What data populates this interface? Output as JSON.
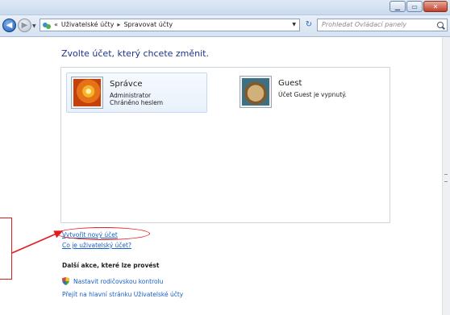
{
  "window": {
    "minimize_icon": "minimize-icon",
    "maximize_icon": "maximize-icon",
    "close_icon": "close-icon"
  },
  "nav": {
    "breadcrumb_prefix": "«",
    "breadcrumbs": [
      "Uživatelské účty",
      "Spravovat účty"
    ],
    "separator": "▸",
    "search_placeholder": "Prohledat Ovládací panely"
  },
  "main": {
    "heading": "Zvolte účet, který chcete změnit.",
    "accounts": [
      {
        "name": "Správce",
        "lines": [
          "Administrator",
          "Chráněno heslem"
        ],
        "avatar": "flower-avatar",
        "selected": true
      },
      {
        "name": "Guest",
        "lines": [
          "Účet Guest je vypnutý."
        ],
        "avatar": "suitcase-avatar",
        "selected": false
      }
    ],
    "links": {
      "create_account": "Vytvořit nový účet",
      "what_is_account": "Co je uživatelský účet?"
    },
    "more_actions": {
      "heading": "Další akce, které lze provést",
      "items": [
        "Nastavit rodičovskou kontrolu",
        "Přejít na hlavní stránku Uživatelské účty"
      ]
    }
  },
  "colors": {
    "link": "#1a5fc4",
    "heading": "#1e3287",
    "annotation": "#e21b1b"
  }
}
